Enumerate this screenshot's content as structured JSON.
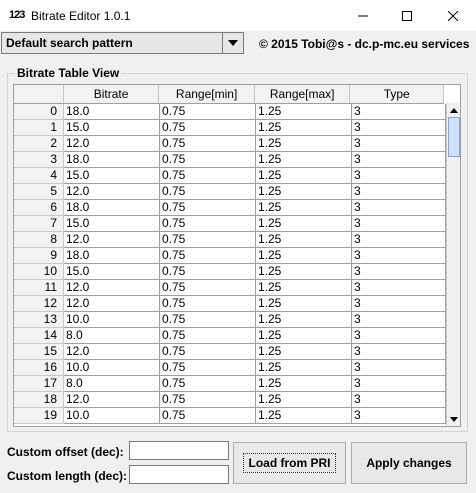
{
  "window": {
    "icon_text": "123",
    "title": "Bitrate Editor 1.0.1"
  },
  "search": {
    "selected": "Default search pattern"
  },
  "copyright": "© 2015 Tobi@s - dc.p-mc.eu services",
  "table_view": {
    "title": "Bitrate Table View",
    "headers": [
      "",
      "Bitrate",
      "Range[min]",
      "Range[max]",
      "Type"
    ],
    "rows": [
      [
        "0",
        "18.0",
        "0.75",
        "1.25",
        "3"
      ],
      [
        "1",
        "15.0",
        "0.75",
        "1.25",
        "3"
      ],
      [
        "2",
        "12.0",
        "0.75",
        "1.25",
        "3"
      ],
      [
        "3",
        "18.0",
        "0.75",
        "1.25",
        "3"
      ],
      [
        "4",
        "15.0",
        "0.75",
        "1.25",
        "3"
      ],
      [
        "5",
        "12.0",
        "0.75",
        "1.25",
        "3"
      ],
      [
        "6",
        "18.0",
        "0.75",
        "1.25",
        "3"
      ],
      [
        "7",
        "15.0",
        "0.75",
        "1.25",
        "3"
      ],
      [
        "8",
        "12.0",
        "0.75",
        "1.25",
        "3"
      ],
      [
        "9",
        "18.0",
        "0.75",
        "1.25",
        "3"
      ],
      [
        "10",
        "15.0",
        "0.75",
        "1.25",
        "3"
      ],
      [
        "11",
        "12.0",
        "0.75",
        "1.25",
        "3"
      ],
      [
        "12",
        "12.0",
        "0.75",
        "1.25",
        "3"
      ],
      [
        "13",
        "10.0",
        "0.75",
        "1.25",
        "3"
      ],
      [
        "14",
        "8.0",
        "0.75",
        "1.25",
        "3"
      ],
      [
        "15",
        "12.0",
        "0.75",
        "1.25",
        "3"
      ],
      [
        "16",
        "10.0",
        "0.75",
        "1.25",
        "3"
      ],
      [
        "17",
        "8.0",
        "0.75",
        "1.25",
        "3"
      ],
      [
        "18",
        "12.0",
        "0.75",
        "1.25",
        "3"
      ],
      [
        "19",
        "10.0",
        "0.75",
        "1.25",
        "3"
      ]
    ]
  },
  "form": {
    "offset_label": "Custom offset (dec):",
    "offset_value": "",
    "length_label": "Custom length (dec):",
    "length_value": ""
  },
  "buttons": {
    "load": "Load from PRI",
    "apply": "Apply changes"
  },
  "icons": {
    "minimize": "minimize-icon",
    "maximize": "maximize-icon",
    "close": "close-icon",
    "dropdown": "chevron-down-icon",
    "scroll_up": "arrow-up-icon",
    "scroll_down": "arrow-down-icon"
  }
}
